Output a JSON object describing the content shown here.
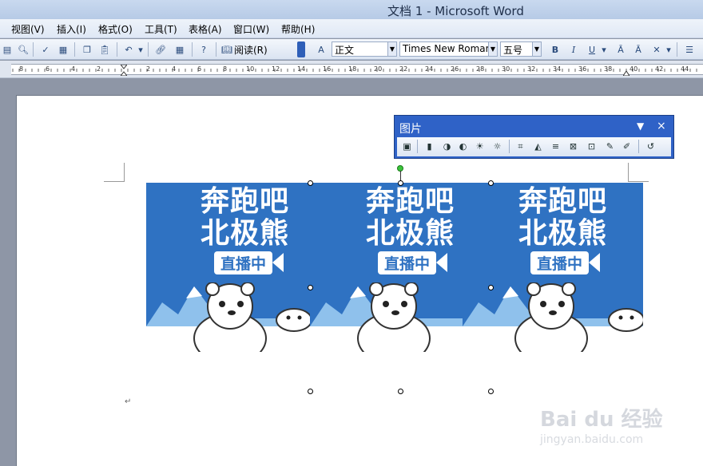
{
  "window": {
    "title": "文档 1 - Microsoft Word"
  },
  "menu": {
    "items": [
      "视图(V)",
      "插入(I)",
      "格式(O)",
      "工具(T)",
      "表格(A)",
      "窗口(W)",
      "帮助(H)"
    ]
  },
  "toolbar": {
    "reading_label": "阅读(R)",
    "style_value": "正文",
    "font_value": "Times New Romar",
    "size_value": "五号"
  },
  "ruler": {
    "labels": [
      "8",
      "6",
      "4",
      "2",
      "2",
      "4",
      "6",
      "8",
      "10",
      "12",
      "14",
      "16",
      "18",
      "20",
      "22",
      "24",
      "26",
      "28",
      "30",
      "32",
      "34",
      "36",
      "38",
      "40",
      "42",
      "44"
    ]
  },
  "picture_toolbar": {
    "title": "图片"
  },
  "picture": {
    "title_line1": "奔跑吧",
    "title_line2": "北极熊",
    "badge": "直播中",
    "bg_color": "#2f72c2"
  },
  "watermark": {
    "text": "Bai du 经验",
    "sub": "jingyan.baidu.com"
  }
}
